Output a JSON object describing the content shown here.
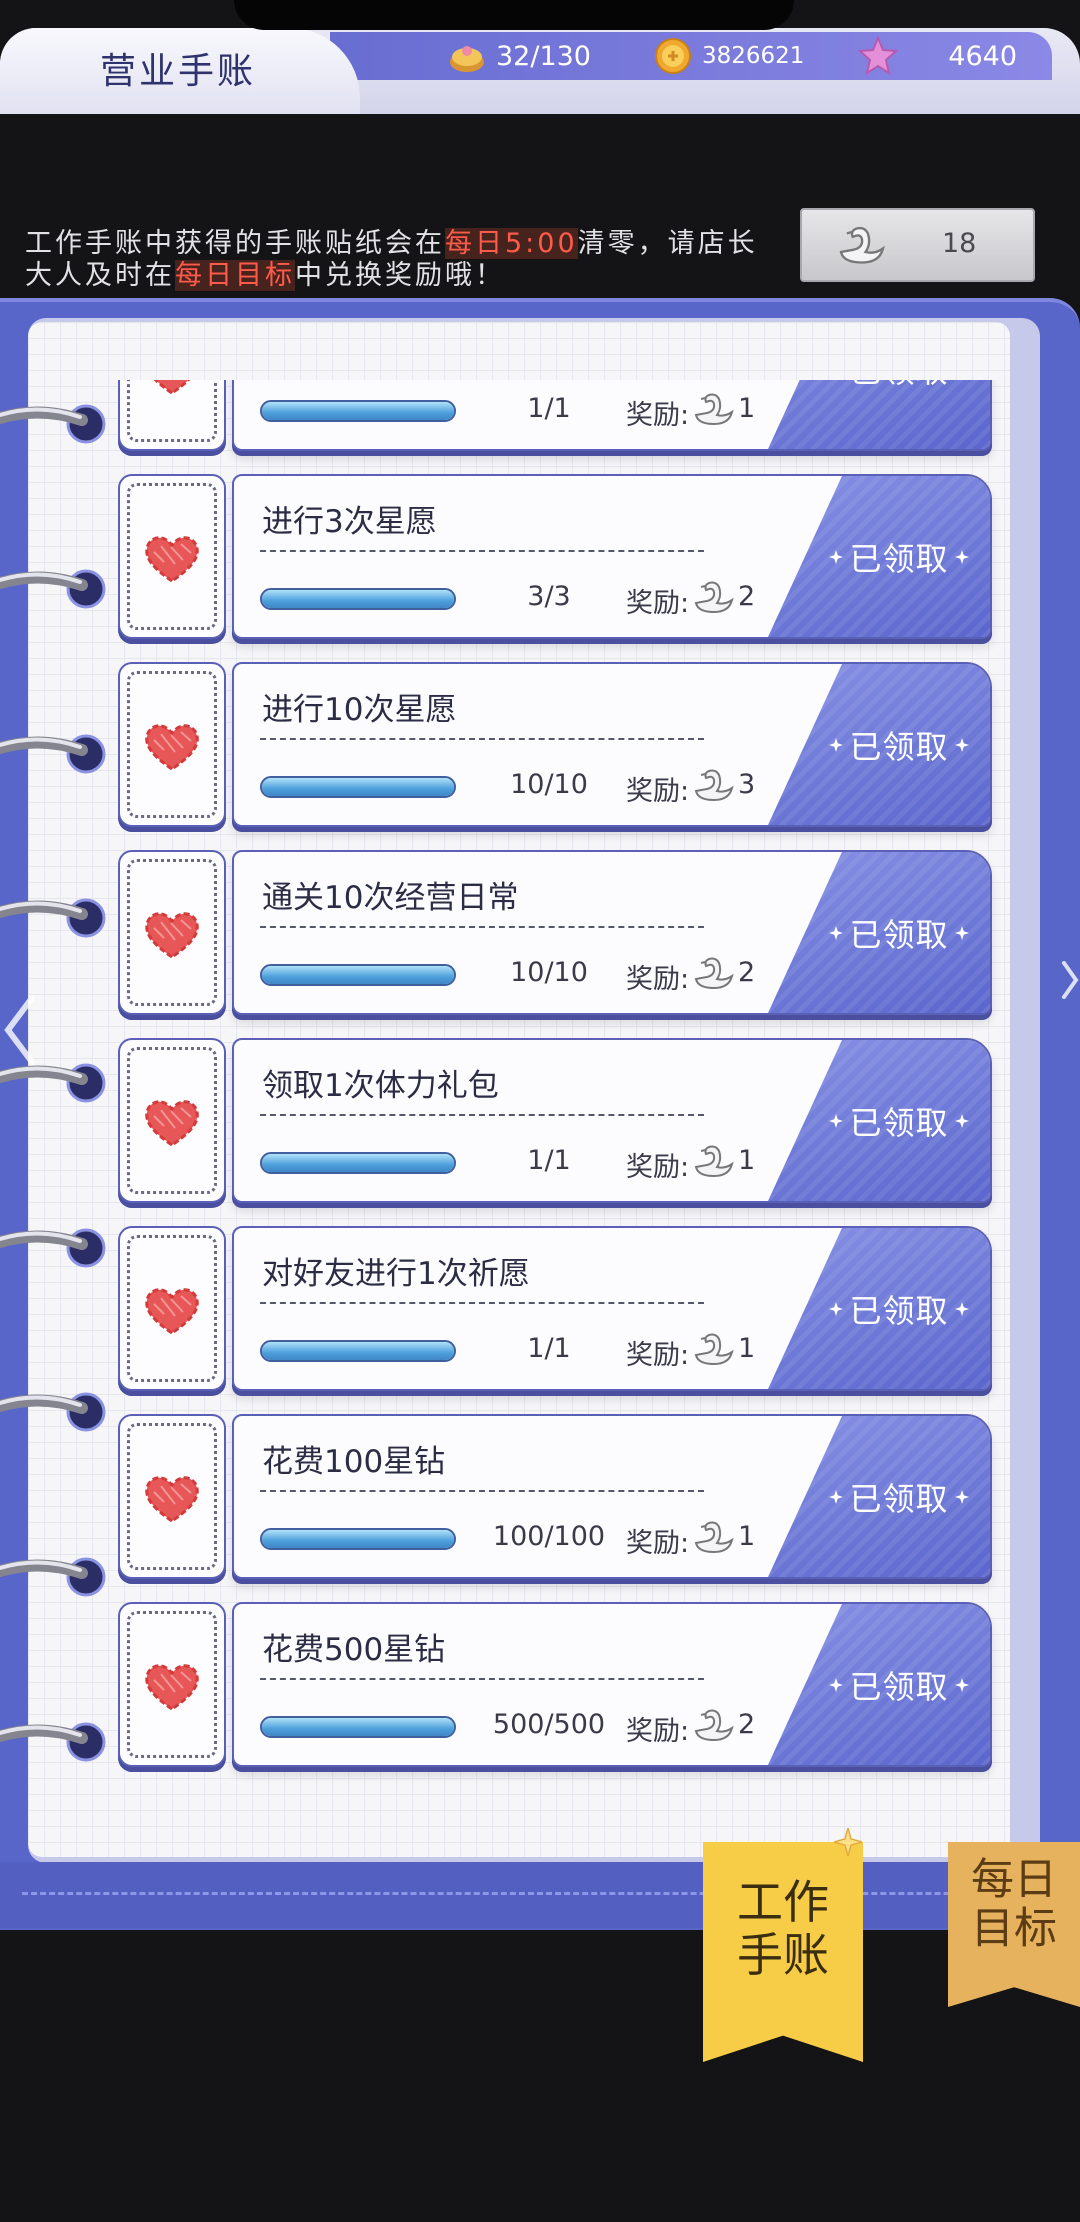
{
  "header": {
    "title": "营业手账",
    "resources": [
      {
        "icon": "pastry-icon",
        "value": "32/130"
      },
      {
        "icon": "coin-icon",
        "value": "3826621"
      },
      {
        "icon": "gem-icon",
        "value": "4640"
      }
    ]
  },
  "notice": {
    "line1": {
      "before": "工作手账中获得的手账贴纸会在",
      "highlight": "每日5:00",
      "after": "清零，请店长"
    },
    "line2": {
      "before": "大人及时在",
      "highlight": "每日目标",
      "after": "中兑换奖励哦！"
    }
  },
  "sticker_balance": {
    "icon": "swan-icon",
    "count": "18"
  },
  "tasks": [
    {
      "progress": "1/1",
      "progress_fraction": 1,
      "reward_label": "奖励:",
      "reward_icon": "swan-icon",
      "reward_count": "1",
      "status": "已领取"
    },
    {
      "title": "进行3次星愿",
      "progress": "3/3",
      "progress_fraction": 1,
      "reward_label": "奖励:",
      "reward_icon": "swan-icon",
      "reward_count": "2",
      "status": "已领取"
    },
    {
      "title": "进行10次星愿",
      "progress": "10/10",
      "progress_fraction": 1,
      "reward_label": "奖励:",
      "reward_icon": "swan-icon",
      "reward_count": "3",
      "status": "已领取"
    },
    {
      "title": "通关10次经营日常",
      "progress": "10/10",
      "progress_fraction": 1,
      "reward_label": "奖励:",
      "reward_icon": "swan-icon",
      "reward_count": "2",
      "status": "已领取"
    },
    {
      "title": "领取1次体力礼包",
      "progress": "1/1",
      "progress_fraction": 1,
      "reward_label": "奖励:",
      "reward_icon": "swan-icon",
      "reward_count": "1",
      "status": "已领取"
    },
    {
      "title": "对好友进行1次祈愿",
      "progress": "1/1",
      "progress_fraction": 1,
      "reward_label": "奖励:",
      "reward_icon": "swan-icon",
      "reward_count": "1",
      "status": "已领取"
    },
    {
      "title": "花费100星钻",
      "progress": "100/100",
      "progress_fraction": 1,
      "reward_label": "奖励:",
      "reward_icon": "swan-icon",
      "reward_count": "1",
      "status": "已领取"
    },
    {
      "title": "花费500星钻",
      "progress": "500/500",
      "progress_fraction": 1,
      "reward_label": "奖励:",
      "reward_icon": "swan-icon",
      "reward_count": "2",
      "status": "已领取"
    }
  ],
  "tabs": [
    {
      "line1": "工作",
      "line2": "手账",
      "active": true
    },
    {
      "line1": "每日",
      "line2": "目标",
      "active": false
    }
  ],
  "colors": {
    "panel": "#5865c9",
    "claim": "#5a66cd",
    "progress": "#4d9fdc",
    "highlight": "#ff5a4a",
    "active_tab": "#f7cd47",
    "inactive_tab": "#e6b25e"
  }
}
